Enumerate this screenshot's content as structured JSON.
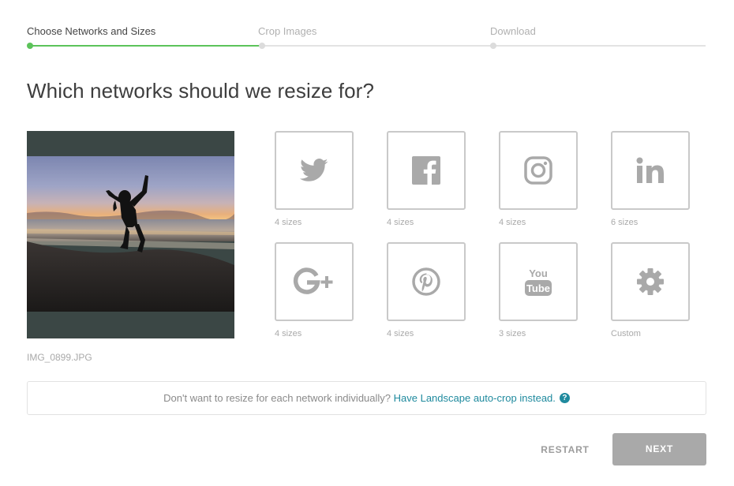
{
  "stepper": {
    "steps": [
      {
        "label": "Choose Networks and Sizes"
      },
      {
        "label": "Crop Images"
      },
      {
        "label": "Download"
      }
    ]
  },
  "heading": "Which networks should we resize for?",
  "preview": {
    "filename": "IMG_0899.JPG"
  },
  "networks": [
    {
      "icon": "twitter-icon",
      "caption": "4 sizes"
    },
    {
      "icon": "facebook-icon",
      "caption": "4 sizes"
    },
    {
      "icon": "instagram-icon",
      "caption": "4 sizes"
    },
    {
      "icon": "linkedin-icon",
      "caption": "6 sizes"
    },
    {
      "icon": "google-plus-icon",
      "caption": "4 sizes"
    },
    {
      "icon": "pinterest-icon",
      "caption": "4 sizes"
    },
    {
      "icon": "youtube-icon",
      "caption": "3 sizes"
    },
    {
      "icon": "gear-icon",
      "caption": "Custom"
    }
  ],
  "notice": {
    "text": "Don't want to resize for each network individually?",
    "link": "Have Landscape auto-crop instead.",
    "help": "?"
  },
  "actions": {
    "restart": "RESTART",
    "next": "NEXT"
  },
  "colors": {
    "accent": "#5cc35a",
    "link": "#1f8a9e",
    "icon": "#a9a9a9",
    "tile_border": "#c9c9c9"
  }
}
